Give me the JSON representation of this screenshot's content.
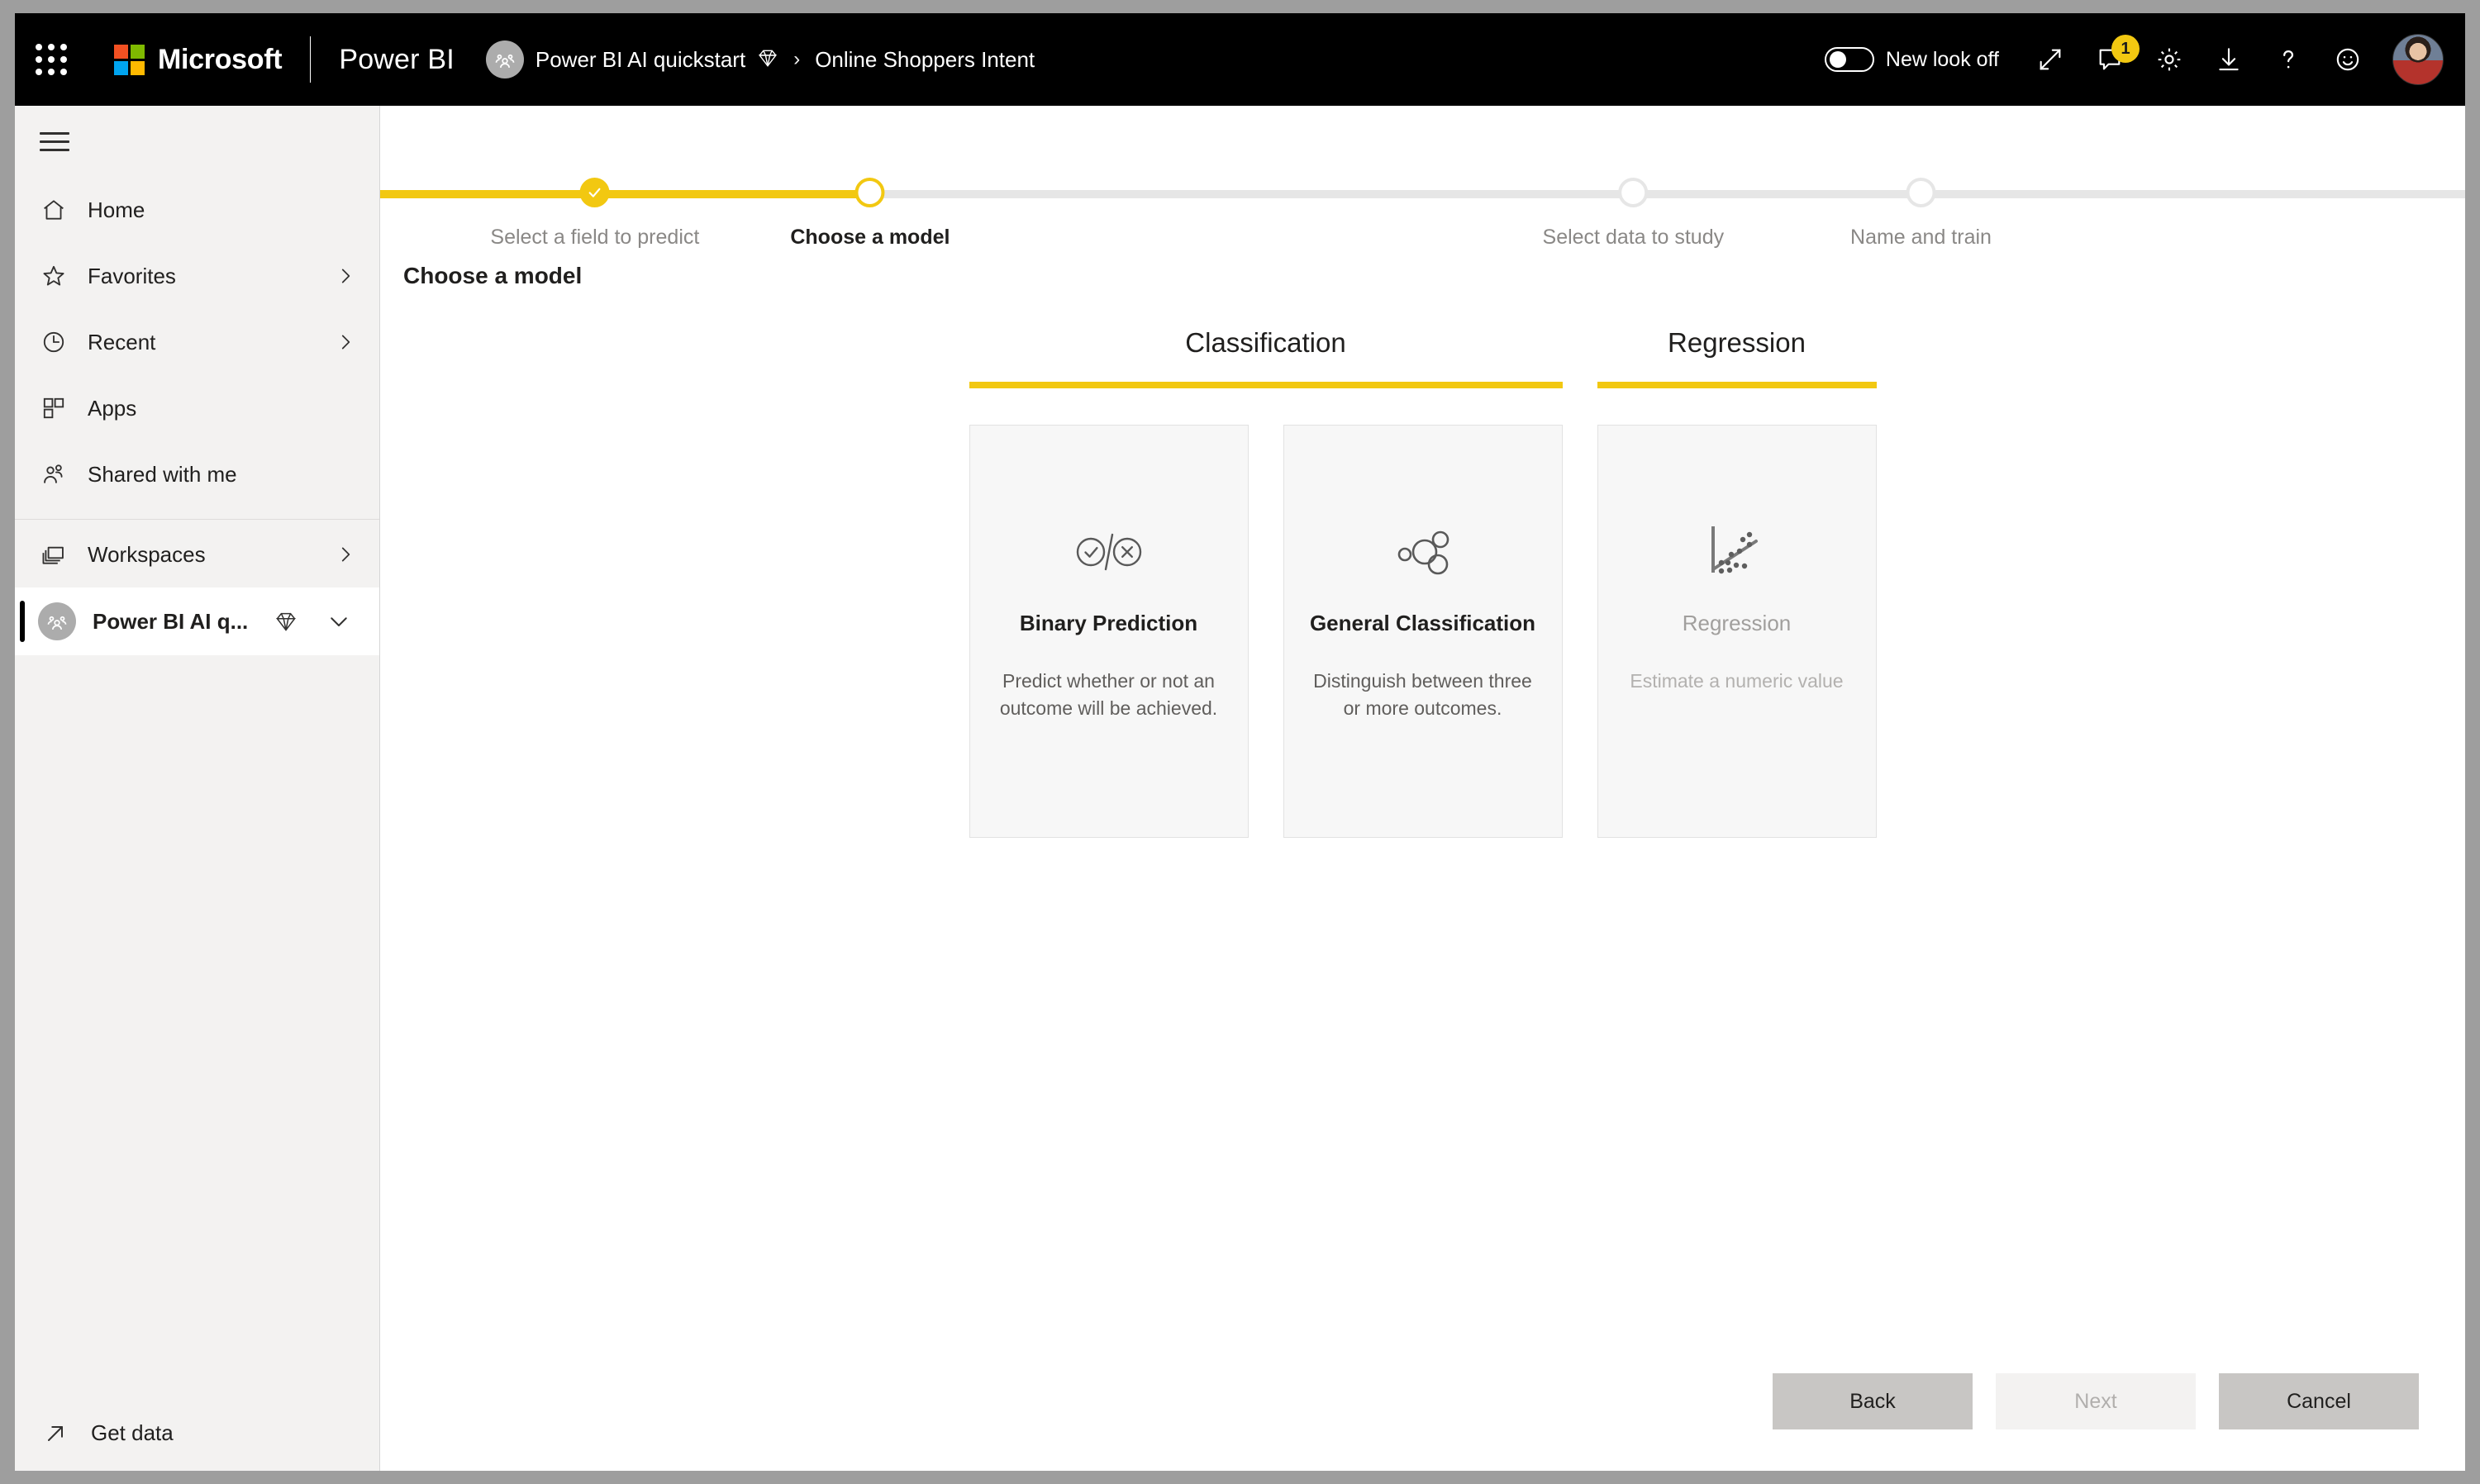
{
  "header": {
    "waffle_label": "app-launcher",
    "microsoft_label": "Microsoft",
    "product_name": "Power BI",
    "breadcrumb": {
      "workspace": "Power BI AI quickstart",
      "separator": "›",
      "current": "Online Shoppers Intent"
    },
    "new_look_label": "New look off",
    "notification_count": "1",
    "icons": [
      "fullscreen-icon",
      "notifications-icon",
      "settings-gear-icon",
      "download-icon",
      "help-icon",
      "feedback-smiley-icon"
    ],
    "ms_logo_colors": [
      "#f25022",
      "#7fba00",
      "#00a4ef",
      "#ffb900"
    ]
  },
  "sidebar": {
    "items": [
      {
        "label": "Home",
        "icon": "home-icon",
        "has_chevron": false
      },
      {
        "label": "Favorites",
        "icon": "star-icon",
        "has_chevron": true
      },
      {
        "label": "Recent",
        "icon": "clock-icon",
        "has_chevron": true
      },
      {
        "label": "Apps",
        "icon": "apps-grid-icon",
        "has_chevron": false
      },
      {
        "label": "Shared with me",
        "icon": "people-icon",
        "has_chevron": false
      }
    ],
    "workspaces": {
      "label": "Workspaces",
      "icon": "workspaces-stack-icon",
      "has_chevron": true
    },
    "active_workspace": {
      "label": "Power BI AI q...",
      "icon": "workspace-avatar-icon",
      "badge_icon": "diamond-icon",
      "caret_icon": "chevron-down-icon"
    },
    "get_data": {
      "label": "Get data",
      "icon": "arrow-up-right-icon"
    }
  },
  "stepper": {
    "steps": [
      {
        "label": "Select a field to predict",
        "state": "done",
        "position_pct": 10.3
      },
      {
        "label": "Choose a model",
        "state": "current",
        "position_pct": 23.5
      },
      {
        "label": "Select data to study",
        "state": "todo",
        "position_pct": 60.1
      },
      {
        "label": "Name and train",
        "state": "todo",
        "position_pct": 73.9
      }
    ],
    "progress_pct": 23.5,
    "track_color_done": "#F2C811",
    "track_color_todo": "#e6e6e6"
  },
  "main": {
    "page_title": "Choose a model",
    "categories": [
      {
        "title": "Classification",
        "cards": [
          {
            "name": "Binary Prediction",
            "description": "Predict whether or not an outcome will be achieved.",
            "icon": "check-cross-circles-icon",
            "disabled": false
          },
          {
            "name": "General Classification",
            "description": "Distinguish between three or more outcomes.",
            "icon": "bubble-cluster-icon",
            "disabled": false
          }
        ]
      },
      {
        "title": "Regression",
        "cards": [
          {
            "name": "Regression",
            "description": "Estimate a numeric value",
            "icon": "scatter-trend-icon",
            "disabled": true
          }
        ]
      }
    ],
    "actions": {
      "back": "Back",
      "next": "Next",
      "cancel": "Cancel"
    }
  },
  "colors": {
    "accent_yellow": "#F2C811",
    "header_black": "#000000",
    "sidebar_bg": "#f3f2f1",
    "card_bg": "#f7f7f7"
  }
}
